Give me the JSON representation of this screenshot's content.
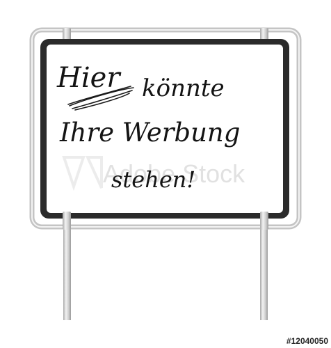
{
  "sign": {
    "line1": "Hier",
    "line2": "könnte",
    "line3": "Ihre Werbung",
    "line4": "stehen!"
  },
  "watermark": {
    "text": "Adobe Stock"
  },
  "stock_id": "#12040050",
  "colors": {
    "background": "#ffffff",
    "sign_face": "#ffffff",
    "sign_border": "#2b2b2b",
    "frame_metal": "#c9c9c9",
    "ink": "#141414"
  }
}
